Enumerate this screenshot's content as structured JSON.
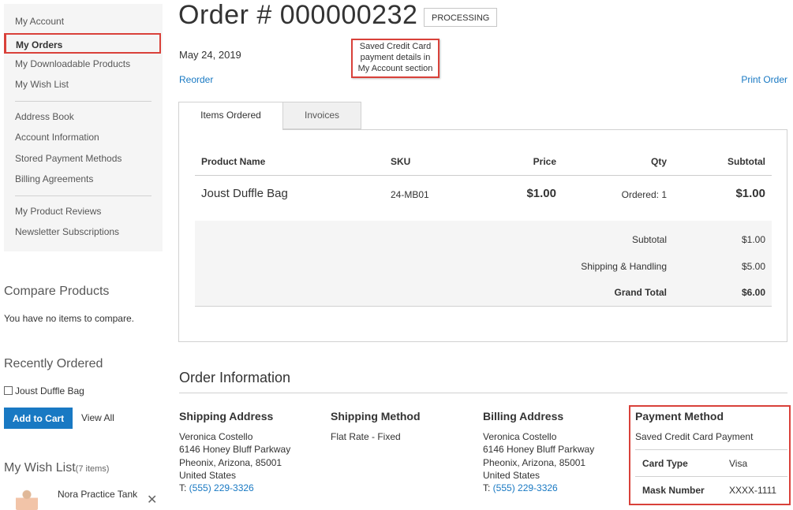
{
  "sidebar": {
    "items": [
      {
        "label": "My Account"
      },
      {
        "label": "My Orders"
      },
      {
        "label": "My Downloadable Products"
      },
      {
        "label": "My Wish List"
      },
      {
        "label": "Address Book"
      },
      {
        "label": "Account Information"
      },
      {
        "label": "Stored Payment Methods"
      },
      {
        "label": "Billing Agreements"
      },
      {
        "label": "My Product Reviews"
      },
      {
        "label": "Newsletter Subscriptions"
      }
    ]
  },
  "compare": {
    "title": "Compare Products",
    "empty_text": "You have no items to compare."
  },
  "recently_ordered": {
    "title": "Recently Ordered",
    "item": "Joust Duffle Bag",
    "add_to_cart": "Add to Cart",
    "view_all": "View All"
  },
  "wishlist": {
    "title": "My Wish List",
    "count": "(7 items)",
    "item": "Nora Practice Tank"
  },
  "order": {
    "title": "Order # 000000232",
    "status": "PROCESSING",
    "date": "May 24, 2019",
    "reorder": "Reorder",
    "print": "Print Order"
  },
  "callout": {
    "line1": "Saved Credit Card",
    "line2": "payment details in",
    "line3": "My Account section"
  },
  "tabs": [
    {
      "label": "Items Ordered"
    },
    {
      "label": "Invoices"
    }
  ],
  "items_table": {
    "headers": {
      "product": "Product Name",
      "sku": "SKU",
      "price": "Price",
      "qty": "Qty",
      "subtotal": "Subtotal"
    },
    "rows": [
      {
        "product": "Joust Duffle Bag",
        "sku": "24-MB01",
        "price": "$1.00",
        "qty": "Ordered: 1",
        "subtotal": "$1.00"
      }
    ],
    "totals": [
      {
        "label": "Subtotal",
        "value": "$1.00"
      },
      {
        "label": "Shipping & Handling",
        "value": "$5.00"
      },
      {
        "label": "Grand Total",
        "value": "$6.00"
      }
    ]
  },
  "order_info": {
    "title": "Order Information",
    "shipping_address": {
      "title": "Shipping Address",
      "name": "Veronica Costello",
      "street": "6146 Honey Bluff Parkway",
      "city": "Pheonix, Arizona, 85001",
      "country": "United States",
      "phone_prefix": "T: ",
      "phone": "(555) 229-3326"
    },
    "shipping_method": {
      "title": "Shipping Method",
      "value": "Flat Rate - Fixed"
    },
    "billing_address": {
      "title": "Billing Address",
      "name": "Veronica Costello",
      "street": "6146 Honey Bluff Parkway",
      "city": "Pheonix, Arizona, 85001",
      "country": "United States",
      "phone_prefix": "T: ",
      "phone": "(555) 229-3326"
    },
    "payment_method": {
      "title": "Payment Method",
      "value": "Saved Credit Card Payment",
      "card_type_label": "Card Type",
      "card_type": "Visa",
      "mask_label": "Mask Number",
      "mask": "XXXX-1111"
    }
  },
  "colors": {
    "accent": "#1979c3",
    "highlight": "#d9413a",
    "nav_bg": "#f5f5f5"
  }
}
